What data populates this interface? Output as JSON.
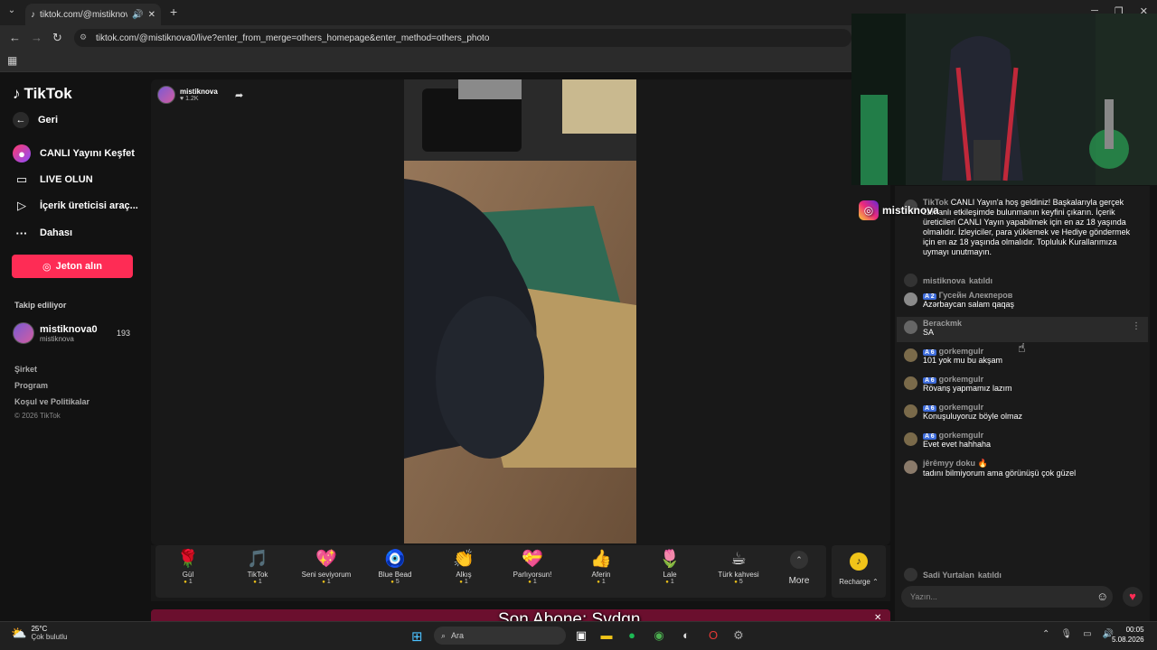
{
  "browser": {
    "tab_title": "tiktok.com/@mistiknova0/l",
    "url": "tiktok.com/@mistiknova0/live?enter_from_merge=others_homepage&enter_method=others_photo"
  },
  "sidebar": {
    "logo": "TikTok",
    "nav": [
      {
        "label": "Geri"
      },
      {
        "label": "CANLI Yayını Keşfet"
      },
      {
        "label": "LIVE OLUN"
      },
      {
        "label": "İçerik üreticisi araç..."
      },
      {
        "label": "Dahası"
      }
    ],
    "coin_button": "Jeton alın",
    "following_heading": "Takip ediliyor",
    "following": {
      "name": "mistiknova0",
      "username": "mistiknova",
      "count": "193"
    },
    "footer": [
      "Şirket",
      "Program",
      "Koşul ve Politikalar"
    ],
    "copyright": "© 2026 TikTok"
  },
  "stream": {
    "host_name": "mistiknova",
    "host_likes": "1.2K",
    "caption": "Son Abone: Svdgn"
  },
  "gifts": [
    {
      "name": "Gül",
      "icon": "🌹",
      "price": "1"
    },
    {
      "name": "TikTok",
      "icon": "🎵",
      "price": "1"
    },
    {
      "name": "Seni seviyorum",
      "icon": "💖",
      "price": "1"
    },
    {
      "name": "Blue Bead",
      "icon": "🧿",
      "price": "5"
    },
    {
      "name": "Alkış",
      "icon": "👏",
      "price": "1"
    },
    {
      "name": "Parlıyorsun!",
      "icon": "💝",
      "price": "1"
    },
    {
      "name": "Aferin",
      "icon": "👍",
      "price": "1"
    },
    {
      "name": "Lale",
      "icon": "🌷",
      "price": "1"
    },
    {
      "name": "Türk kahvesi",
      "icon": "☕",
      "price": "5"
    }
  ],
  "gift_more": "More",
  "recharge": "Recharge",
  "webcam": {
    "instagram_handle": "mistiknova"
  },
  "chat": {
    "welcome_user": "TikTok",
    "welcome": "CANLI Yayın'a hoş geldiniz! Başkalarıyla gerçek zamanlı etkileşimde bulunmanın keyfini çıkarın. İçerik üreticileri CANLI Yayın yapabilmek için en az 18 yaşında olmalıdır. İzleyiciler, para yüklemek ve Hediye göndermek için en az 18 yaşında olmalıdır. Topluluk Kurallarımıza uymayı unutmayın.",
    "messages": [
      {
        "user": "mistiknova",
        "level": "",
        "text": "",
        "joined": "katıldı"
      },
      {
        "user": "Гусейн Алекперов",
        "level": "2",
        "text": "Azərbaycan salam qaqaş",
        "joined": ""
      },
      {
        "user": "Berackmk",
        "level": "",
        "text": "SA",
        "joined": ""
      },
      {
        "user": "gorkemgulr",
        "level": "6",
        "text": "101 yok mu bu akşam",
        "joined": ""
      },
      {
        "user": "gorkemgulr",
        "level": "6",
        "text": "Rövanş yapmamız lazım",
        "joined": ""
      },
      {
        "user": "gorkemgulr",
        "level": "6",
        "text": "Konuşuluyoruz böyle olmaz",
        "joined": ""
      },
      {
        "user": "gorkemgulr",
        "level": "6",
        "text": "Evet evet hahhaha",
        "joined": ""
      },
      {
        "user": "jêrêmyy doku",
        "level": "",
        "text": "tadını bilmiyorum ama görünüşü çok güzel",
        "joined": ""
      }
    ],
    "bottom_join": {
      "user": "Sadi Yurtalan",
      "joined": "katıldı"
    },
    "input_placeholder": "Yazın..."
  },
  "taskbar": {
    "temp": "25°C",
    "weather": "Çok bulutlu",
    "search": "Ara",
    "time": "00:05",
    "date": "5.08.2026"
  }
}
